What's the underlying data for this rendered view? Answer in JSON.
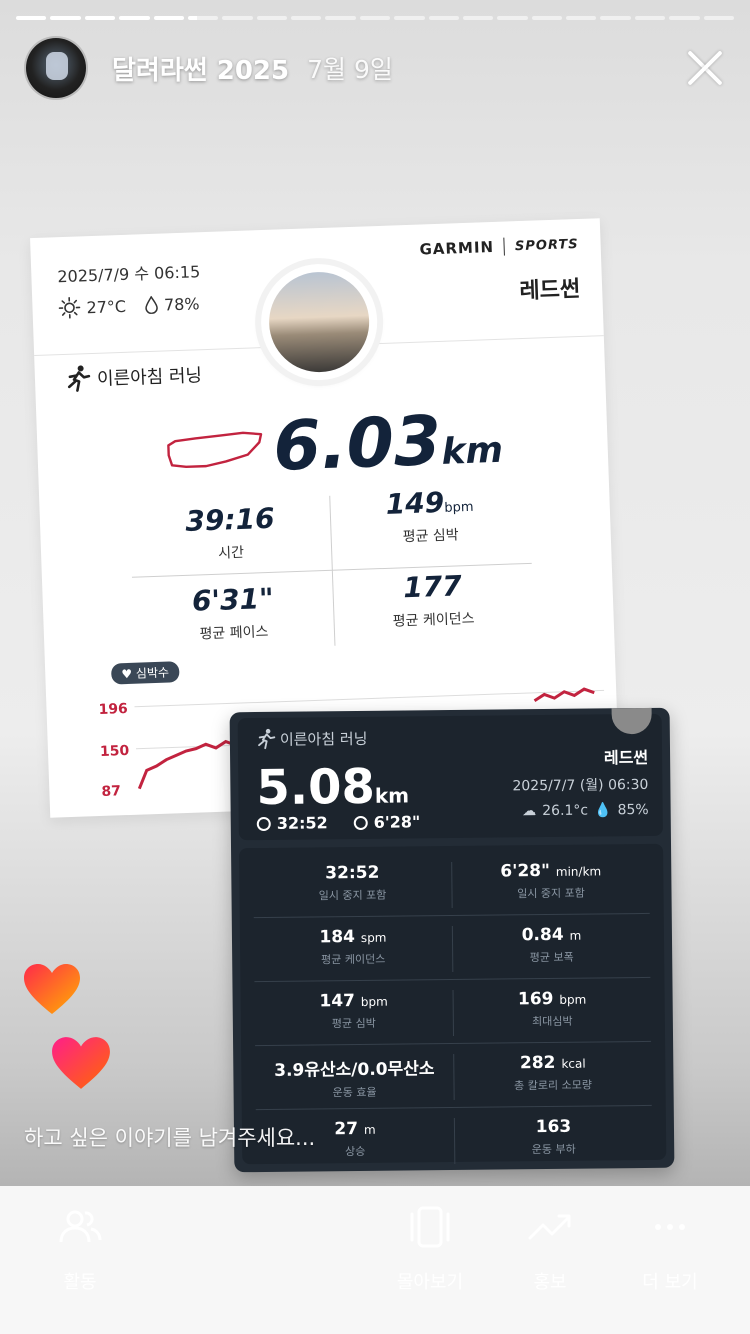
{
  "story": {
    "segments": [
      "done",
      "done",
      "done",
      "done",
      "done",
      "active",
      "todo",
      "todo",
      "todo",
      "todo",
      "todo",
      "todo",
      "todo",
      "todo",
      "todo",
      "todo",
      "todo",
      "todo",
      "todo",
      "todo",
      "todo"
    ],
    "account": "달려라썬 2025",
    "date": "7월 9일",
    "reply_placeholder": "하고 싶은 이야기를 남겨주세요..."
  },
  "garmin_card": {
    "datetime": "2025/7/9 수 06:15",
    "temp": "27°C",
    "humidity": "78%",
    "brand": "GARMIN",
    "brand_sub": "SPORTS",
    "team": "레드썬",
    "activity": "이른아침 러닝",
    "distance": "6.03",
    "distance_unit": "km",
    "stats": {
      "time_value": "39:16",
      "time_label": "시간",
      "hr_value": "149",
      "hr_unit": "bpm",
      "hr_label": "평균 심박",
      "pace_value": "6'31\"",
      "pace_label": "평균 페이스",
      "cad_value": "177",
      "cad_label": "평균 케이던스"
    },
    "hr_tag": "심박수",
    "hr_axis": [
      "196",
      "150",
      "87"
    ]
  },
  "dark_card": {
    "activity": "이른아침 러닝",
    "team": "레드썬",
    "distance": "5.08",
    "distance_unit": "km",
    "date": "2025/7/7 (월) 06:30",
    "temp": "26.1°c",
    "humidity": "85%",
    "time": "32:52",
    "pace": "6'28\"",
    "rows": [
      {
        "lv": "32:52",
        "lu": "",
        "ll": "일시 중지 포함",
        "rv": "6'28\"",
        "ru": "min/km",
        "rl": "일시 중지 포함"
      },
      {
        "lv": "184",
        "lu": "spm",
        "ll": "평균 케이던스",
        "rv": "0.84",
        "ru": "m",
        "rl": "평균 보폭"
      },
      {
        "lv": "147",
        "lu": "bpm",
        "ll": "평균 심박",
        "rv": "169",
        "ru": "bpm",
        "rl": "최대심박"
      },
      {
        "lv": "3.9유산소/0.0무산소",
        "lu": "",
        "ll": "운동 효율",
        "rv": "282",
        "ru": "kcal",
        "rl": "총 칼로리 소모량"
      },
      {
        "lv": "27",
        "lu": "m",
        "ll": "상승",
        "rv": "163",
        "ru": "",
        "rl": "운동 부하"
      }
    ]
  },
  "bottom_bar": {
    "activity": "활동",
    "collage": "몰아보기",
    "insights": "홍보",
    "more": "더 보기"
  },
  "colors": {
    "accent_red": "#c2233f",
    "navy": "#13233a",
    "dark_card": "#232c36"
  }
}
